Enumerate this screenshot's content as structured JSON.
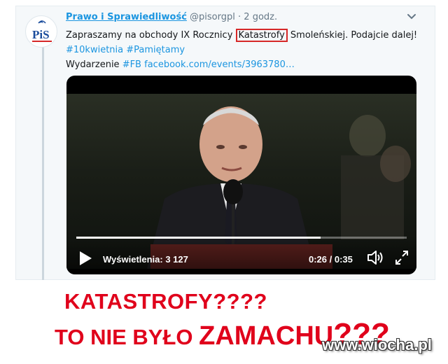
{
  "tweet": {
    "author_name": "Prawo i Sprawiedliwość",
    "handle": "@pisorgpl",
    "separator": "·",
    "time": "2 godz.",
    "avatar_text": "PiS",
    "text_before": "Zapraszamy na obchody IX Rocznicy ",
    "text_highlight": "Katastrofy",
    "text_after": " Smoleńskiej. Podajcie dalej!",
    "hashtags": "#10kwietnia #Pamiętamy",
    "event_prefix": "Wydarzenie ",
    "event_hashtag": "#FB",
    "event_link": "facebook.com/events/3963780…"
  },
  "video": {
    "views_text": "Wyświetlenia: 3 127",
    "time_text": "0:26 / 0:35",
    "progress_fraction": 0.74
  },
  "overlay": {
    "line1": "KATASTROFY????",
    "line2_a": "TO NIE BYŁO ",
    "line2_b": "ZAMACHU",
    "line2_c": "???"
  },
  "watermark": "www.wiocha.pl",
  "colors": {
    "link": "#1b95e0",
    "highlight_border": "#d62828",
    "caption": "#e0001b"
  }
}
